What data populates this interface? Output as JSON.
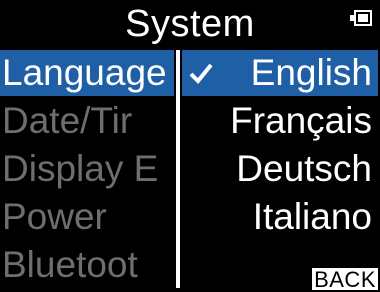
{
  "header": {
    "title": "System"
  },
  "left_menu": {
    "items": [
      {
        "label": "Language",
        "selected": true
      },
      {
        "label": "Date/Tir",
        "selected": false
      },
      {
        "label": "Display E",
        "selected": false
      },
      {
        "label": "Power",
        "selected": false
      },
      {
        "label": "Bluetoot",
        "selected": false
      }
    ]
  },
  "language_options": {
    "items": [
      {
        "label": "English",
        "selected": true
      },
      {
        "label": "Français",
        "selected": false
      },
      {
        "label": "Deutsch",
        "selected": false
      },
      {
        "label": "Italiano",
        "selected": false
      }
    ],
    "back_label": "BACK"
  },
  "colors": {
    "highlight": "#1e5fa5",
    "dimmed_text": "#6e6e6e"
  },
  "icons": {
    "battery": "battery-icon",
    "check": "checkmark-icon"
  }
}
